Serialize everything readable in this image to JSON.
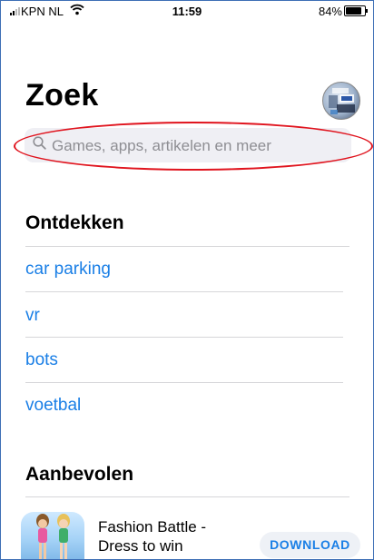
{
  "status_bar": {
    "carrier": "KPN NL",
    "time": "11:59",
    "battery_percent": "84%",
    "battery_level": 0.84,
    "icons": [
      "signal-icon",
      "wifi-icon",
      "battery-icon"
    ]
  },
  "header": {
    "title": "Zoek",
    "avatar_icon": "profile-avatar-icon"
  },
  "search": {
    "placeholder": "Games, apps, artikelen en meer",
    "icon": "search-icon",
    "annotation_color": "#e0141e"
  },
  "discover": {
    "heading": "Ontdekken",
    "items": [
      {
        "label": "car parking"
      },
      {
        "label": "vr"
      },
      {
        "label": "bots"
      },
      {
        "label": "voetbal"
      }
    ]
  },
  "recommended": {
    "heading": "Aanbevolen",
    "apps": [
      {
        "name": "Fashion Battle - Dress to win",
        "button": "DOWNLOAD"
      }
    ]
  },
  "colors": {
    "link": "#1a7fe6",
    "search_bg": "#efeff4",
    "placeholder": "#8e8e93",
    "frame_border": "#3d6fb5"
  }
}
